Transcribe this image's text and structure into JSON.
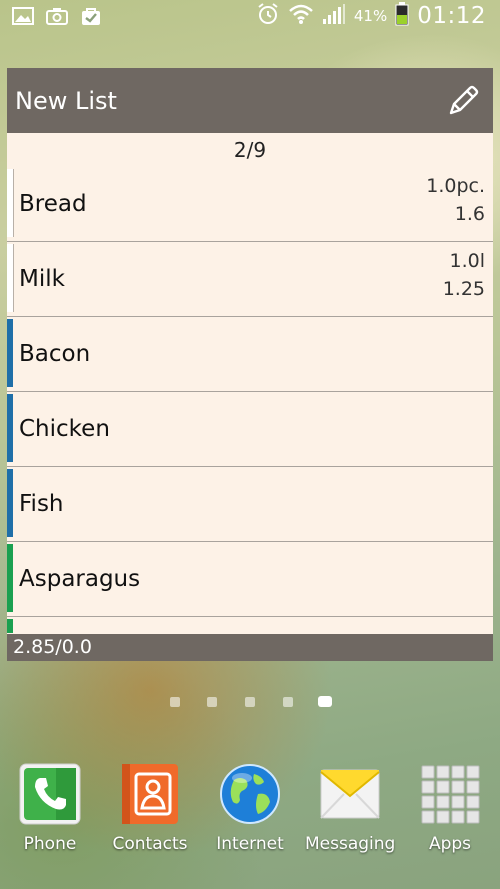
{
  "status_bar": {
    "battery_percent": "41%",
    "time": "01:12"
  },
  "widget": {
    "title": "New List",
    "counter": "2/9",
    "items": [
      {
        "name": "Bread",
        "quantity": "1.0pc.",
        "price": "1.6",
        "color": "#ffffff"
      },
      {
        "name": "Milk",
        "quantity": "1.0l",
        "price": "1.25",
        "color": "#ffffff"
      },
      {
        "name": "Bacon",
        "quantity": "",
        "price": "",
        "color": "#1f6fa8"
      },
      {
        "name": "Chicken",
        "quantity": "",
        "price": "",
        "color": "#1f6fa8"
      },
      {
        "name": "Fish",
        "quantity": "",
        "price": "",
        "color": "#1f6fa8"
      },
      {
        "name": "Asparagus",
        "quantity": "",
        "price": "",
        "color": "#1aa050"
      }
    ],
    "partial_item_color": "#1aa050",
    "footer_total": "2.85/0.0"
  },
  "page_indicator": {
    "count": 5,
    "active_index": 4
  },
  "dock": [
    {
      "label": "Phone",
      "icon": "phone-icon"
    },
    {
      "label": "Contacts",
      "icon": "contacts-icon"
    },
    {
      "label": "Internet",
      "icon": "globe-icon"
    },
    {
      "label": "Messaging",
      "icon": "envelope-icon"
    },
    {
      "label": "Apps",
      "icon": "apps-grid-icon"
    }
  ]
}
